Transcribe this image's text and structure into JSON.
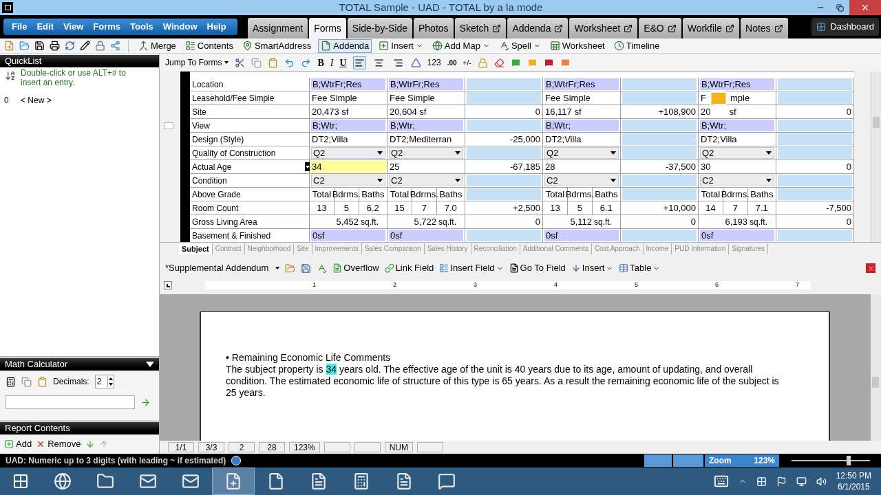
{
  "window": {
    "title": "TOTAL Sample - UAD - TOTAL by a la mode"
  },
  "menu": [
    "File",
    "Edit",
    "View",
    "Forms",
    "Tools",
    "Window",
    "Help"
  ],
  "tabs": [
    {
      "label": "Assignment",
      "selected": false,
      "popout": false
    },
    {
      "label": "Forms",
      "selected": true,
      "popout": false
    },
    {
      "label": "Side-by-Side",
      "selected": false,
      "popout": false
    },
    {
      "label": "Photos",
      "selected": false,
      "popout": false
    },
    {
      "label": "Sketch",
      "selected": false,
      "popout": true
    },
    {
      "label": "Addenda",
      "selected": false,
      "popout": true
    },
    {
      "label": "Worksheet",
      "selected": false,
      "popout": true
    },
    {
      "label": "E&O",
      "selected": false,
      "popout": true
    },
    {
      "label": "Workfile",
      "selected": false,
      "popout": true
    },
    {
      "label": "Notes",
      "selected": false,
      "popout": true
    }
  ],
  "dashboard": "Dashboard",
  "toolbar": [
    {
      "label": "Merge",
      "pressed": false,
      "dropdown": false
    },
    {
      "label": "Contents",
      "pressed": false,
      "dropdown": false
    },
    {
      "label": "SmartAddress",
      "pressed": false,
      "dropdown": false
    },
    {
      "label": "Addenda",
      "pressed": true,
      "dropdown": false
    },
    {
      "label": "Insert",
      "pressed": false,
      "dropdown": true
    },
    {
      "label": "Add Map",
      "pressed": false,
      "dropdown": true
    },
    {
      "label": "Spell",
      "pressed": false,
      "dropdown": true
    },
    {
      "label": "Worksheet",
      "pressed": false,
      "dropdown": false
    },
    {
      "label": "Timeline",
      "pressed": false,
      "dropdown": false
    }
  ],
  "quicklist": {
    "title": "QuickList",
    "hint": "Double-click or use ALT+# to insert an entry.",
    "items": [
      {
        "key": "0",
        "label": "< New >"
      }
    ]
  },
  "math_calculator": {
    "title": "Math Calculator",
    "decimals_label": "Decimals:",
    "decimals": "2"
  },
  "report_contents": {
    "title": "Report Contents",
    "add": "Add",
    "remove": "Remove"
  },
  "format_bar": {
    "jump": "Jump To Forms",
    "bold": "B",
    "italic": "I",
    "underline": "U",
    "alignment": [
      {
        "selected": true
      },
      {
        "selected": false
      },
      {
        "selected": false
      }
    ],
    "number": "123",
    "decimal": ".00",
    "sign": "+/-"
  },
  "grid": {
    "rows": [
      {
        "label": "Location",
        "cells": [
          {
            "kind": "uad",
            "text": "B;WtrFr;Res"
          },
          {
            "kind": "uad",
            "text": "B;WtrFr;Res"
          },
          {
            "kind": "adj"
          },
          {
            "kind": "uad",
            "text": "B;WtrFr;Res"
          },
          {
            "kind": "adj"
          },
          {
            "kind": "uad",
            "text": "B;WtrFr;Res"
          },
          {
            "kind": "adj"
          }
        ]
      },
      {
        "label": "Leasehold/Fee Simple",
        "cells": [
          {
            "kind": "text",
            "text": "Fee Simple"
          },
          {
            "kind": "text",
            "text": "Fee Simple"
          },
          {
            "kind": "adj"
          },
          {
            "kind": "text",
            "text": "Fee Simple"
          },
          {
            "kind": "adj"
          },
          {
            "kind": "covered",
            "parts": [
              "F",
              "mple"
            ]
          },
          {
            "kind": "adj"
          }
        ]
      },
      {
        "label": "Site",
        "cells": [
          {
            "kind": "text",
            "text": "20,473 sf"
          },
          {
            "kind": "text",
            "text": "20,604 sf"
          },
          {
            "kind": "adj",
            "text": "0"
          },
          {
            "kind": "text",
            "text": "16,117 sf"
          },
          {
            "kind": "adj",
            "text": "+108,900"
          },
          {
            "kind": "covered",
            "parts": [
              "20",
              "sf"
            ]
          },
          {
            "kind": "adj",
            "text": "0"
          }
        ]
      },
      {
        "label": "View",
        "cells": [
          {
            "kind": "uad",
            "text": "B;Wtr;"
          },
          {
            "kind": "uad",
            "text": "B;Wtr;"
          },
          {
            "kind": "adj"
          },
          {
            "kind": "uad",
            "text": "B;Wtr;"
          },
          {
            "kind": "adj"
          },
          {
            "kind": "uad",
            "text": "B;Wtr;"
          },
          {
            "kind": "adj"
          }
        ]
      },
      {
        "label": "Design (Style)",
        "cells": [
          {
            "kind": "text",
            "text": "DT2;Villa"
          },
          {
            "kind": "text",
            "text": "DT2;Mediterran"
          },
          {
            "kind": "adj",
            "text": "-25,000"
          },
          {
            "kind": "text",
            "text": "DT2;Villa"
          },
          {
            "kind": "adj"
          },
          {
            "kind": "text",
            "text": "DT2;Villa"
          },
          {
            "kind": "adj"
          }
        ]
      },
      {
        "label": "Quality of Construction",
        "cells": [
          {
            "kind": "select",
            "text": "Q2"
          },
          {
            "kind": "select",
            "text": "Q2"
          },
          {
            "kind": "adj"
          },
          {
            "kind": "select",
            "text": "Q2"
          },
          {
            "kind": "adj"
          },
          {
            "kind": "select",
            "text": "Q2"
          },
          {
            "kind": "adj"
          }
        ]
      },
      {
        "label": "Actual Age",
        "cells": [
          {
            "kind": "active",
            "text": "34"
          },
          {
            "kind": "text",
            "text": "25"
          },
          {
            "kind": "adj",
            "text": "-67,185"
          },
          {
            "kind": "text",
            "text": "28"
          },
          {
            "kind": "adj",
            "text": "-37,500"
          },
          {
            "kind": "text",
            "text": "30"
          },
          {
            "kind": "adj",
            "text": "0"
          }
        ]
      },
      {
        "label": "Condition",
        "cells": [
          {
            "kind": "select",
            "text": "C2"
          },
          {
            "kind": "select",
            "text": "C2"
          },
          {
            "kind": "adj"
          },
          {
            "kind": "select",
            "text": "C2"
          },
          {
            "kind": "adj"
          },
          {
            "kind": "select",
            "text": "C2"
          },
          {
            "kind": "adj"
          }
        ]
      },
      {
        "label": "Above Grade",
        "cells": [
          {
            "kind": "heads",
            "parts": [
              "Total",
              "Bdrms.",
              "Baths"
            ]
          },
          {
            "kind": "heads",
            "parts": [
              "Total",
              "Bdrms.",
              "Baths"
            ]
          },
          {
            "kind": "adj"
          },
          {
            "kind": "heads",
            "parts": [
              "Total",
              "Bdrms.",
              "Baths"
            ]
          },
          {
            "kind": "adj"
          },
          {
            "kind": "heads",
            "parts": [
              "Total",
              "Bdrms.",
              "Baths"
            ]
          },
          {
            "kind": "adj"
          }
        ]
      },
      {
        "label": "Room Count",
        "cells": [
          {
            "kind": "rooms",
            "parts": [
              "13",
              "5",
              "6.2"
            ]
          },
          {
            "kind": "rooms",
            "parts": [
              "15",
              "7",
              "7.0"
            ]
          },
          {
            "kind": "adj",
            "text": "+2,500"
          },
          {
            "kind": "rooms",
            "parts": [
              "13",
              "5",
              "6.1"
            ]
          },
          {
            "kind": "adj",
            "text": "+10,000"
          },
          {
            "kind": "rooms",
            "parts": [
              "14",
              "7",
              "7.1"
            ]
          },
          {
            "kind": "adj",
            "text": "-7,500"
          }
        ]
      },
      {
        "label": "Gross Living Area",
        "cells": [
          {
            "kind": "area",
            "text": "5,452",
            "unit": "sq.ft."
          },
          {
            "kind": "area",
            "text": "5,722",
            "unit": "sq.ft."
          },
          {
            "kind": "adj",
            "text": "0"
          },
          {
            "kind": "area",
            "text": "5,112",
            "unit": "sq.ft."
          },
          {
            "kind": "adj",
            "text": "0"
          },
          {
            "kind": "area",
            "text": "6,193",
            "unit": "sq.ft."
          },
          {
            "kind": "adj",
            "text": "0"
          }
        ]
      },
      {
        "label": "Basement & Finished",
        "cells": [
          {
            "kind": "uad",
            "text": "0sf"
          },
          {
            "kind": "uad",
            "text": "0sf"
          },
          {
            "kind": "adj"
          },
          {
            "kind": "uad",
            "text": "0sf"
          },
          {
            "kind": "adj"
          },
          {
            "kind": "uad",
            "text": "0sf"
          },
          {
            "kind": "adj"
          }
        ]
      }
    ]
  },
  "form_tabs": [
    {
      "label": "Subject",
      "selected": true
    },
    {
      "label": "Contract",
      "selected": false
    },
    {
      "label": "Neighborhood",
      "selected": false
    },
    {
      "label": "Site",
      "selected": false
    },
    {
      "label": "Improvements",
      "selected": false
    },
    {
      "label": "Sales Comparison",
      "selected": false
    },
    {
      "label": "Sales History",
      "selected": false
    },
    {
      "label": "Reconciliation",
      "selected": false
    },
    {
      "label": "Additional Comments",
      "selected": false
    },
    {
      "label": "Cost Approach",
      "selected": false
    },
    {
      "label": "Income",
      "selected": false
    },
    {
      "label": "PUD Information",
      "selected": false
    },
    {
      "label": "Signatures",
      "selected": false
    }
  ],
  "addendum_bar": {
    "document": "*Supplemental Addendum",
    "overflow": "Overflow",
    "link_field": "Link Field",
    "insert_field": "Insert Field",
    "go_to_field": "Go To Field",
    "insert": "Insert",
    "table": "Table"
  },
  "ruler_marks": [
    "1",
    "2",
    "3",
    "4",
    "5",
    "6",
    "7"
  ],
  "document": {
    "heading": "• Remaining Economic Life Comments",
    "before": "The subject property is ",
    "highlight": "34",
    "after": " years old.  The effective age of the unit is 40 years due to its age, amount of updating, and overall condition.  The estimated economic life of structure of this type is 65 years.  As a result the remaining economic life of the subject is 25 years."
  },
  "doc_status": [
    {
      "kind": "text",
      "text": "1/1"
    },
    {
      "kind": "text",
      "text": "3/3"
    },
    {
      "kind": "text",
      "text": "2"
    },
    {
      "kind": "text",
      "text": "28"
    },
    {
      "kind": "text",
      "text": "123%"
    },
    {
      "kind": "blank"
    },
    {
      "kind": "blank"
    },
    {
      "kind": "text",
      "text": "NUM"
    },
    {
      "kind": "blank"
    }
  ],
  "status_bar": {
    "message": "UAD: Numeric up to 3 digits (with leading ~ if estimated)",
    "zoom_label": "Zoom",
    "zoom_value": "123%",
    "zoom": {
      "level": 0.75
    }
  },
  "taskbar": {
    "apps": [
      {
        "selected": false
      },
      {
        "selected": false
      },
      {
        "selected": false
      },
      {
        "selected": false
      },
      {
        "selected": true
      },
      {
        "selected": false
      },
      {
        "selected": false
      },
      {
        "selected": false
      },
      {
        "selected": false
      },
      {
        "selected": false
      }
    ],
    "time": "12:50 PM",
    "date": "6/1/2015"
  }
}
